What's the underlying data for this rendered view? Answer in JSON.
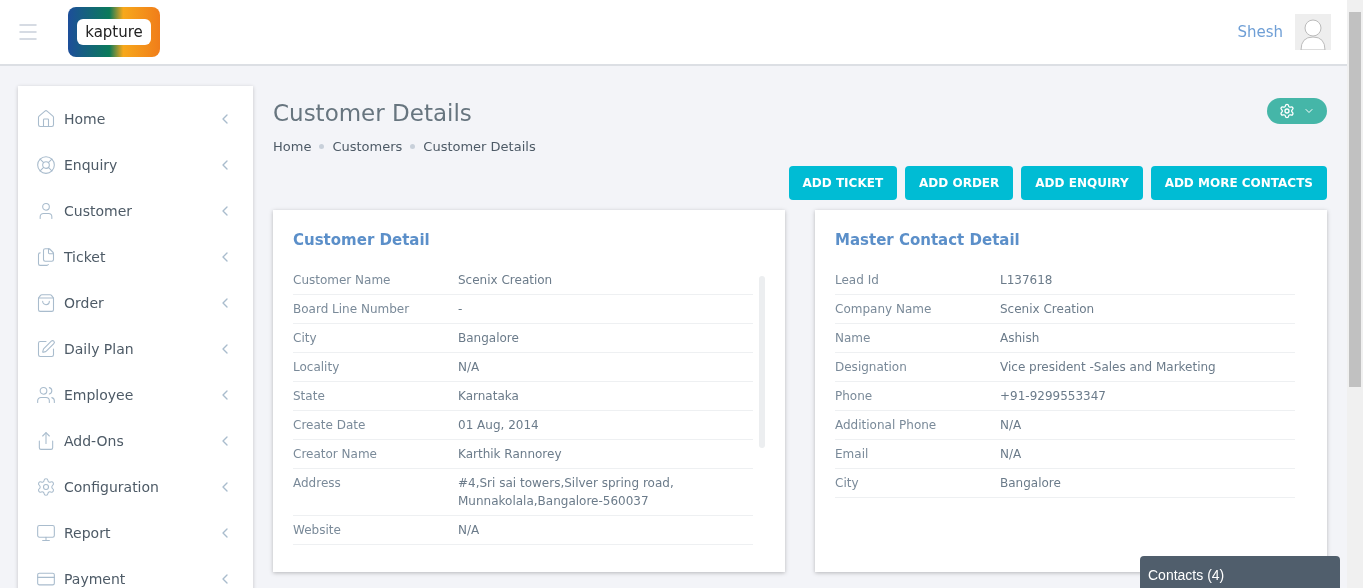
{
  "header": {
    "logo_text": "kapture",
    "user_name": "Shesh"
  },
  "sidebar": {
    "items": [
      {
        "label": "Home"
      },
      {
        "label": "Enquiry"
      },
      {
        "label": "Customer"
      },
      {
        "label": "Ticket"
      },
      {
        "label": "Order"
      },
      {
        "label": "Daily Plan"
      },
      {
        "label": "Employee"
      },
      {
        "label": "Add-Ons"
      },
      {
        "label": "Configuration"
      },
      {
        "label": "Report"
      },
      {
        "label": "Payment"
      }
    ]
  },
  "page": {
    "title": "Customer Details",
    "breadcrumb": [
      "Home",
      "Customers",
      "Customer Details"
    ],
    "actions": [
      "ADD TICKET",
      "ADD ORDER",
      "ADD ENQUIRY",
      "ADD MORE CONTACTS"
    ]
  },
  "customer_detail": {
    "title": "Customer Detail",
    "rows": [
      {
        "label": "Customer Name",
        "value": "Scenix Creation"
      },
      {
        "label": "Board Line Number",
        "value": "-"
      },
      {
        "label": "City",
        "value": "Bangalore"
      },
      {
        "label": "Locality",
        "value": "N/A"
      },
      {
        "label": "State",
        "value": "Karnataka"
      },
      {
        "label": "Create Date",
        "value": "01 Aug, 2014"
      },
      {
        "label": "Creator Name",
        "value": "Karthik Rannorey"
      },
      {
        "label": "Address",
        "value": "#4,Sri sai towers,Silver spring road, Munnakolala,Bangalore-560037"
      },
      {
        "label": "Website",
        "value": "N/A"
      }
    ]
  },
  "master_contact": {
    "title": "Master Contact Detail",
    "rows": [
      {
        "label": "Lead Id",
        "value": "L137618"
      },
      {
        "label": "Company Name",
        "value": "Scenix Creation"
      },
      {
        "label": "Name",
        "value": "Ashish"
      },
      {
        "label": "Designation",
        "value": "Vice president -Sales and Marketing"
      },
      {
        "label": "Phone",
        "value": "+91-9299553347"
      },
      {
        "label": "Additional Phone",
        "value": "N/A"
      },
      {
        "label": "Email",
        "value": "N/A"
      },
      {
        "label": "City",
        "value": "Bangalore"
      }
    ]
  },
  "contacts_bar": {
    "label": "Contacts (4)"
  }
}
